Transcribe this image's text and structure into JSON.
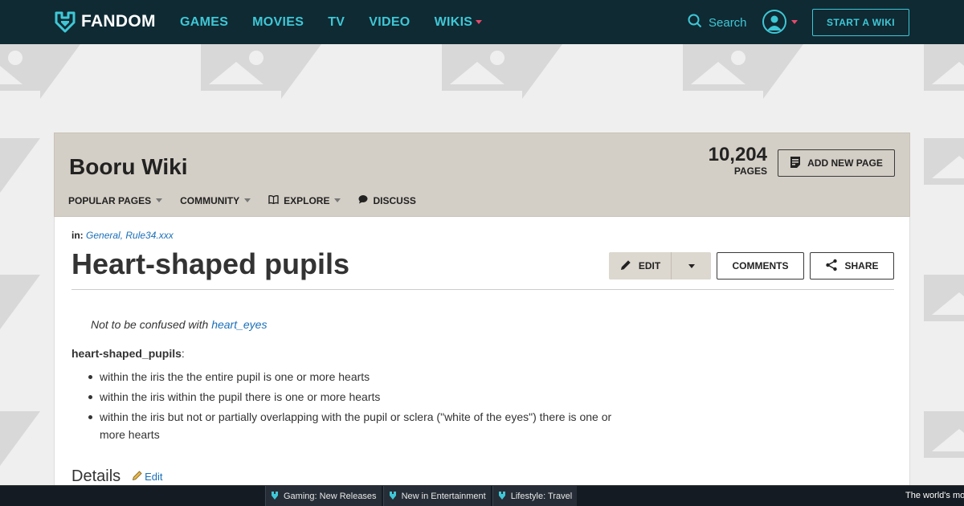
{
  "top_nav": {
    "logo_text": "FANDOM",
    "links": [
      {
        "label": "GAMES"
      },
      {
        "label": "MOVIES"
      },
      {
        "label": "TV"
      },
      {
        "label": "VIDEO"
      },
      {
        "label": "WIKIS",
        "has_dropdown": true
      }
    ],
    "search_label": "Search",
    "start_wiki_label": "START A WIKI"
  },
  "wiki": {
    "title": "Booru Wiki",
    "page_count": "10,204",
    "page_count_label": "PAGES",
    "add_page_label": "ADD NEW PAGE",
    "nav": [
      {
        "label": "POPULAR PAGES",
        "icon": "",
        "has_dropdown": true
      },
      {
        "label": "COMMUNITY",
        "icon": "",
        "has_dropdown": true
      },
      {
        "label": "EXPLORE",
        "icon": "book-icon",
        "has_dropdown": true
      },
      {
        "label": "DISCUSS",
        "icon": "chat-icon",
        "has_dropdown": false
      }
    ]
  },
  "article": {
    "categories_label": "in:",
    "categories": "General, Rule34.xxx",
    "title": "Heart-shaped pupils",
    "edit_label": "EDIT",
    "comments_label": "COMMENTS",
    "share_label": "SHARE",
    "note_prefix": "Not to be confused with ",
    "note_link": "heart_eyes",
    "term": "heart-shaped_pupils",
    "term_suffix": ":",
    "definitions": [
      "within the iris the the entire pupil is one or more hearts",
      "within the iris within the pupil there is one or more hearts",
      "within the iris but not or partially overlapping with the pupil or sclera (\"white of the eyes\") there is one or more hearts"
    ],
    "section_heading": "Details",
    "section_edit_label": "Edit"
  },
  "bottom_bar": {
    "items": [
      "Gaming: New Releases",
      "New in Entertainment",
      "Lifestyle: Travel"
    ],
    "right_text": "The world's mo"
  },
  "colors": {
    "nav_bg": "#0f2a33",
    "accent": "#3fc7d6",
    "dropdown_caret": "#e8496b",
    "header_bg": "#d4cfc6",
    "link": "#1a6fb8"
  }
}
